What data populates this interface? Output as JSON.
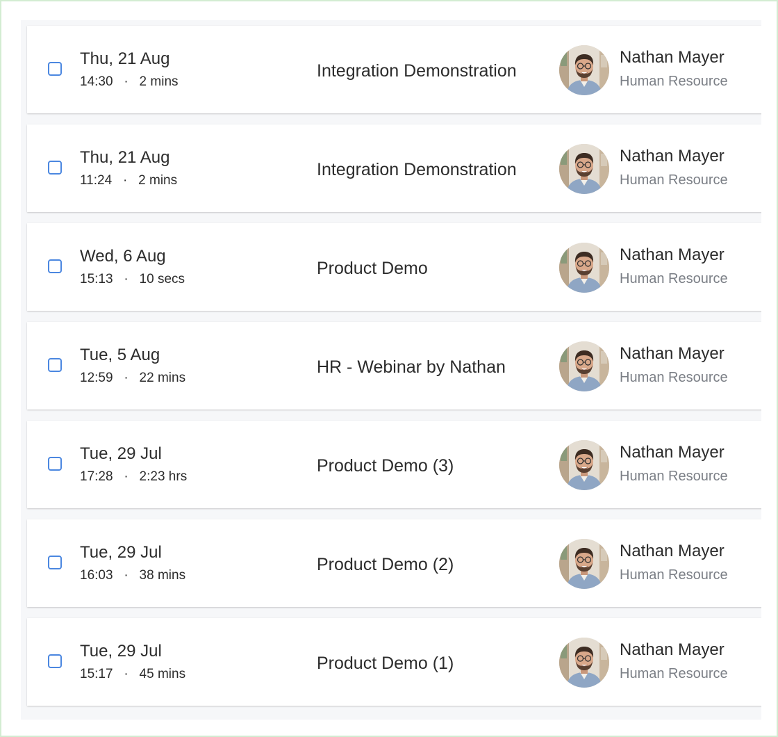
{
  "recordings": [
    {
      "date": "Thu, 21 Aug",
      "time": "14:30",
      "duration": "2 mins",
      "title": "Integration Demonstration",
      "host": {
        "name": "Nathan Mayer",
        "department": "Human Resource"
      }
    },
    {
      "date": "Thu, 21 Aug",
      "time": "11:24",
      "duration": "2 mins",
      "title": "Integration Demonstration",
      "host": {
        "name": "Nathan Mayer",
        "department": "Human Resource"
      }
    },
    {
      "date": "Wed, 6 Aug",
      "time": "15:13",
      "duration": "10 secs",
      "title": "Product Demo",
      "host": {
        "name": "Nathan Mayer",
        "department": "Human Resource"
      }
    },
    {
      "date": "Tue, 5 Aug",
      "time": "12:59",
      "duration": "22 mins",
      "title": "HR - Webinar by Nathan",
      "host": {
        "name": "Nathan Mayer",
        "department": "Human Resource"
      }
    },
    {
      "date": "Tue, 29 Jul",
      "time": "17:28",
      "duration": "2:23 hrs",
      "title": "Product Demo (3)",
      "host": {
        "name": "Nathan Mayer",
        "department": "Human Resource"
      }
    },
    {
      "date": "Tue, 29 Jul",
      "time": "16:03",
      "duration": "38 mins",
      "title": "Product Demo (2)",
      "host": {
        "name": "Nathan Mayer",
        "department": "Human Resource"
      }
    },
    {
      "date": "Tue, 29 Jul",
      "time": "15:17",
      "duration": "45 mins",
      "title": "Product Demo (1)",
      "host": {
        "name": "Nathan Mayer",
        "department": "Human Resource"
      }
    }
  ],
  "separator": "·",
  "colors": {
    "checkbox": "#4b87e0",
    "text": "#2c2c2c",
    "secondary_text": "#7b7f86",
    "list_background": "#f6f7f9",
    "frame_border": "#d3ecd2"
  }
}
